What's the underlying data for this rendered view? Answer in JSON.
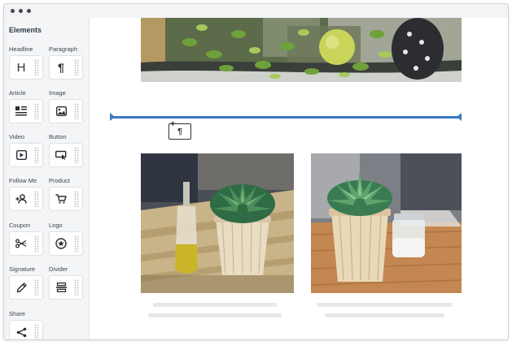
{
  "window": {
    "controls": [
      "dot",
      "dot",
      "dot"
    ]
  },
  "sidebar": {
    "title": "Elements",
    "items": [
      {
        "label": "Headline",
        "icon": "headline-icon",
        "glyph": "H"
      },
      {
        "label": "Paragraph",
        "icon": "paragraph-icon",
        "glyph": "¶"
      },
      {
        "label": "Article",
        "icon": "article-icon"
      },
      {
        "label": "Image",
        "icon": "image-icon"
      },
      {
        "label": "Video",
        "icon": "video-icon"
      },
      {
        "label": "Button",
        "icon": "button-icon"
      },
      {
        "label": "Follow Me",
        "icon": "follow-me-icon"
      },
      {
        "label": "Product",
        "icon": "cart-icon"
      },
      {
        "label": "Coupon",
        "icon": "scissors-icon"
      },
      {
        "label": "Logo",
        "icon": "star-badge-icon"
      },
      {
        "label": "Signature",
        "icon": "pen-icon"
      },
      {
        "label": "Divider",
        "icon": "divider-icon"
      },
      {
        "label": "Share",
        "icon": "share-icon"
      }
    ]
  },
  "canvas": {
    "drag_ghost_glyph": "¶",
    "drop_indicator_color": "#3a78c2",
    "images": [
      {
        "name": "hero-plants-image",
        "subject": "green plants and lemon in jars"
      },
      {
        "name": "succulent-left-image",
        "subject": "succulent in wooden pot with oil bottle"
      },
      {
        "name": "succulent-right-image",
        "subject": "succulent in wooden pot with salt jar"
      }
    ]
  }
}
